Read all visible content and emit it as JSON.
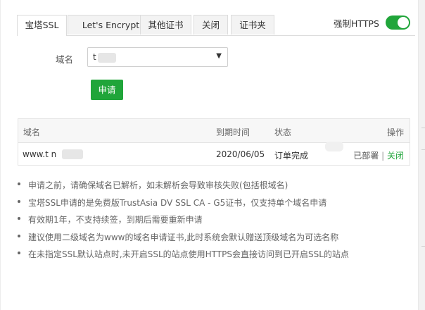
{
  "tabs": [
    {
      "label": "宝塔SSL",
      "active": true
    },
    {
      "label": "Let's Encrypt",
      "active": false
    },
    {
      "label": "其他证书",
      "active": false
    },
    {
      "label": "关闭",
      "active": false
    },
    {
      "label": "证书夹",
      "active": false
    }
  ],
  "https_toggle": {
    "label": "强制HTTPS",
    "on": true,
    "color": "#20a53a"
  },
  "form": {
    "domain_label": "域名",
    "domain_value": "t        n",
    "apply_label": "申请"
  },
  "table": {
    "headers": [
      "域名",
      "到期时间",
      "状态",
      "操作"
    ],
    "rows": [
      {
        "domain": "www.t         n",
        "expiry": "2020/06/05",
        "status": "订单完成",
        "deployed": "已部署",
        "separator": "|",
        "close": "关闭"
      }
    ]
  },
  "notes": [
    "申请之前，请确保域名已解析，如未解析会导致审核失败(包括根域名)",
    "宝塔SSL申请的是免费版TrustAsia DV SSL CA - G5证书，仅支持单个域名申请",
    "有效期1年，不支持续签，到期后需要重新申请",
    "建议使用二级域名为www的域名申请证书,此时系统会默认赠送顶级域名为可选名称",
    "在未指定SSL默认站点时,未开启SSL的站点使用HTTPS会直接访问到已开启SSL的站点"
  ],
  "colors": {
    "accent": "#20a53a"
  }
}
